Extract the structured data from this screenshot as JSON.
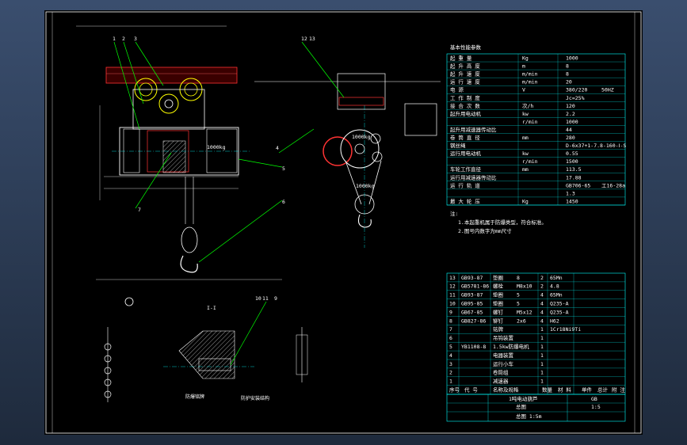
{
  "drawing": {
    "spec_title": "基本性能参数",
    "spec_rows": [
      [
        "起 重 量",
        "Kg",
        "1000"
      ],
      [
        "起 升 高 度",
        "m",
        "8"
      ],
      [
        "起 升 速 度",
        "m/min",
        "8"
      ],
      [
        "运 行 速 度",
        "m/min",
        "20"
      ],
      [
        "电 源",
        "V",
        "380/220",
        "50HZ"
      ],
      [
        "工 作 制 度",
        "",
        "Jc=25%"
      ],
      [
        "接 合 次 数",
        "次/h",
        "120"
      ],
      [
        "起升用电动机",
        "kw",
        "2.2"
      ],
      [
        "",
        "r/min",
        "1000"
      ],
      [
        "起升用减速器传动比",
        "",
        "44"
      ],
      [
        "卷 筒 直 径",
        "mm",
        "280"
      ],
      [
        "钢丝绳",
        "",
        "D-6x37+1-7.8-160-Ⅰ-S"
      ],
      [
        "运行用电动机",
        "kw",
        "0.55"
      ],
      [
        "",
        "r/min",
        "1500"
      ],
      [
        "车轮工作直径",
        "mm",
        "113.5"
      ],
      [
        "运行用减速器传动比",
        "",
        "17.88"
      ],
      [
        "运 行 轨 道",
        "",
        "GB706-65",
        "工16-28a"
      ],
      [
        "",
        "",
        "1.3"
      ],
      [
        "最 大 轮 压",
        "Kg",
        "1450"
      ]
    ],
    "notes_title": "注:",
    "notes": [
      "1.本起重机属于防爆类型，符合标准。",
      "2.图号内数字为mm尺寸"
    ],
    "bom_rows": [
      [
        "13",
        "GB93-87",
        "垫圈",
        "8",
        "2",
        "65Mn"
      ],
      [
        "12",
        "GB5781-86",
        "螺栓",
        "M8x10",
        "2",
        "4.8"
      ],
      [
        "11",
        "GB93-87",
        "垫圈",
        "5",
        "4",
        "65Mn"
      ],
      [
        "10",
        "GB95-85",
        "垫圈",
        "5",
        "4",
        "Q235-A"
      ],
      [
        "9",
        "GB67-85",
        "螺钉",
        "M5x12",
        "4",
        "Q235-A"
      ],
      [
        "8",
        "GB827-86",
        "铆钉",
        "2x6",
        "4",
        "H62"
      ],
      [
        "7",
        "",
        "铭牌",
        "",
        "1",
        "1Cr18Ni9Ti"
      ],
      [
        "6",
        "",
        "吊钩装置",
        "",
        "1",
        ""
      ],
      [
        "5",
        "YB1108-8",
        "1.5kw防爆电机",
        "",
        "1",
        ""
      ],
      [
        "4",
        "",
        "电器装置",
        "",
        "1",
        ""
      ],
      [
        "3",
        "",
        "运行小车",
        "",
        "1",
        ""
      ],
      [
        "2",
        "",
        "卷筒组",
        "",
        "1",
        ""
      ],
      [
        "1",
        "",
        "减速器",
        "",
        "1",
        ""
      ]
    ],
    "bom_header": [
      "序号",
      "代 号",
      "名称及规格",
      "数量",
      "材 料",
      "单件",
      "总计",
      "附 注"
    ],
    "title_block": {
      "name": "1吨电动葫芦",
      "drawing_label": "总图",
      "scale": "1:5",
      "sheet": "总图  1:5m",
      "code": "GB"
    },
    "view_labels": {
      "capacity_main": "1000kg",
      "capacity_side_top": "1000kg",
      "capacity_side_bottom": "1000kg",
      "section": "I-I",
      "nameplate_note": "防爆铭牌",
      "chain_note": "防护安装结构"
    },
    "callouts": [
      "1",
      "2",
      "3",
      "4",
      "5",
      "6",
      "7",
      "8",
      "9",
      "10",
      "11",
      "12",
      "13"
    ]
  },
  "colors": {
    "frame": "#ffffff",
    "leader": "#00ff00",
    "yellow": "#ffff00",
    "cyan": "#00ffff",
    "red": "#ff0000",
    "magenta": "#ff33ff"
  }
}
